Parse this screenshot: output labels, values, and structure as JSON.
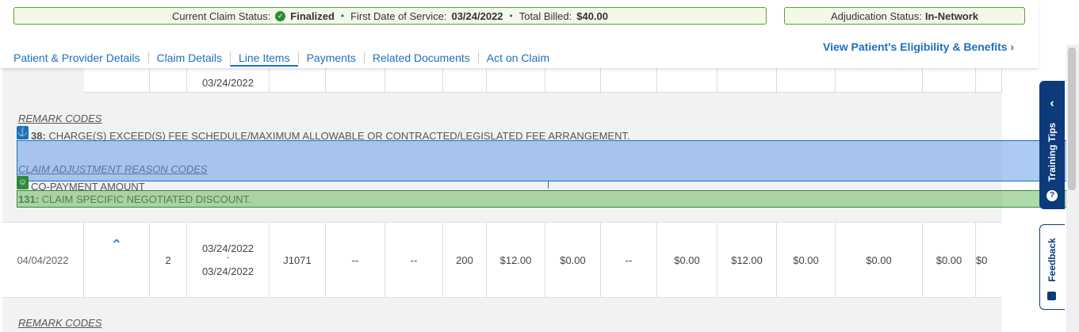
{
  "status": {
    "current_label": "Current Claim Status:",
    "current_value": "Finalized",
    "dos_label": "First Date of Service:",
    "dos_value": "03/24/2022",
    "billed_label": "Total Billed:",
    "billed_value": "$40.00",
    "adj_label": "Adjudication Status:",
    "adj_value": "In-Network"
  },
  "eligibility_link": "View Patient's Eligibility & Benefits ›",
  "tabs": [
    "Patient & Provider Details",
    "Claim Details",
    "Line Items",
    "Payments",
    "Related Documents",
    "Act on Claim"
  ],
  "active_tab": "Line Items",
  "prev_row": {
    "dos_end": "03/24/2022"
  },
  "remark_header": "REMARK CODES",
  "remark_code": "38:",
  "remark_text": "CHARGE(S) EXCEED(S) FEE SCHEDULE/MAXIMUM ALLOWABLE OR CONTRACTED/LEGISLATED FEE ARRANGEMENT.",
  "carc_header": "CLAIM ADJUSTMENT REASON CODES",
  "carc_items": [
    {
      "code": "",
      "text": "CO-PAYMENT AMOUNT"
    },
    {
      "code": "131:",
      "text": "CLAIM SPECIFIC NEGOTIATED DISCOUNT."
    }
  ],
  "row": {
    "date": "04/04/2022",
    "line": "2",
    "dos_start": "03/24/2022",
    "dos_sep": "-",
    "dos_end": "03/24/2022",
    "code": "J1071",
    "mod1": "--",
    "mod2": "--",
    "units": "200",
    "billed": "$12.00",
    "c1": "$0.00",
    "c2": "--",
    "c3": "$0.00",
    "c4": "$12.00",
    "c5": "$0.00",
    "c6": "$0.00",
    "c7": "$0.00",
    "c8": "$0"
  },
  "remark_header_2": "REMARK CODES",
  "side_tabs": {
    "training": "Training Tips",
    "feedback": "Feedback"
  },
  "colors": {
    "link": "#1c6fbf",
    "status_border": "#5a9e3a",
    "side_tab": "#0d3a7a"
  }
}
